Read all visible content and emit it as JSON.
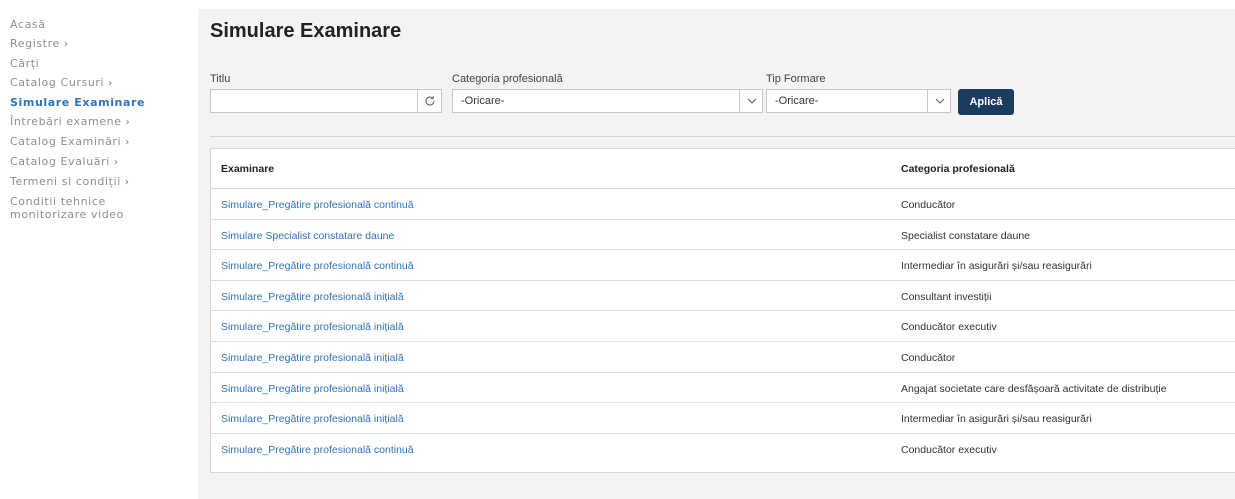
{
  "sidebar": {
    "items": [
      {
        "label": "Acasă",
        "chevron": false,
        "active": false
      },
      {
        "label": "Registre",
        "chevron": true,
        "active": false
      },
      {
        "label": "Cărți",
        "chevron": false,
        "active": false
      },
      {
        "label": "Catalog Cursuri",
        "chevron": true,
        "active": false
      },
      {
        "label": "Simulare Examinare",
        "chevron": false,
        "active": true
      },
      {
        "label": "Întrebări examene",
        "chevron": true,
        "active": false
      },
      {
        "label": "Catalog Examinări",
        "chevron": true,
        "active": false
      },
      {
        "label": "Catalog Evaluări",
        "chevron": true,
        "active": false
      },
      {
        "label": "Termeni si condiții",
        "chevron": true,
        "active": false
      },
      {
        "label": "Conditii tehnice monitorizare video",
        "chevron": false,
        "active": false
      }
    ],
    "chevron_glyph": "›"
  },
  "main": {
    "title": "Simulare Examinare",
    "filters": {
      "titlu_label": "Titlu",
      "titlu_value": "",
      "categorie_label": "Categoria profesională",
      "categorie_value": "-Oricare-",
      "tip_label": "Tip Formare",
      "tip_value": "-Oricare-",
      "apply_label": "Aplică"
    },
    "table": {
      "headers": [
        "Examinare",
        "Categoria profesională"
      ],
      "rows": [
        {
          "examinare": "Simulare_Pregătire profesională continuă",
          "categorie": "Conducător"
        },
        {
          "examinare": "Simulare Specialist constatare daune",
          "categorie": "Specialist constatare daune"
        },
        {
          "examinare": "Simulare_Pregătire profesională continuă",
          "categorie": "Intermediar în asigurări și/sau reasigurări"
        },
        {
          "examinare": "Simulare_Pregătire profesională inițială",
          "categorie": "Consultant investiții"
        },
        {
          "examinare": "Simulare_Pregătire profesională inițială",
          "categorie": "Conducător executiv"
        },
        {
          "examinare": "Simulare_Pregătire profesională inițială",
          "categorie": "Conducător"
        },
        {
          "examinare": "Simulare_Pregătire profesională inițială",
          "categorie": "Angajat societate care desfășoară activitate de distribuție"
        },
        {
          "examinare": "Simulare_Pregătire profesională inițială",
          "categorie": "Intermediar în asigurări și/sau reasigurări"
        },
        {
          "examinare": "Simulare_Pregătire profesională continuă",
          "categorie": "Conducător executiv"
        }
      ]
    }
  },
  "colors": {
    "accent_link": "#2f73b8",
    "apply_button": "#1b3b5f",
    "main_bg": "#f3f3f3"
  },
  "icons": {
    "refresh": "refresh-icon",
    "dropdown": "chevron-down-icon"
  }
}
